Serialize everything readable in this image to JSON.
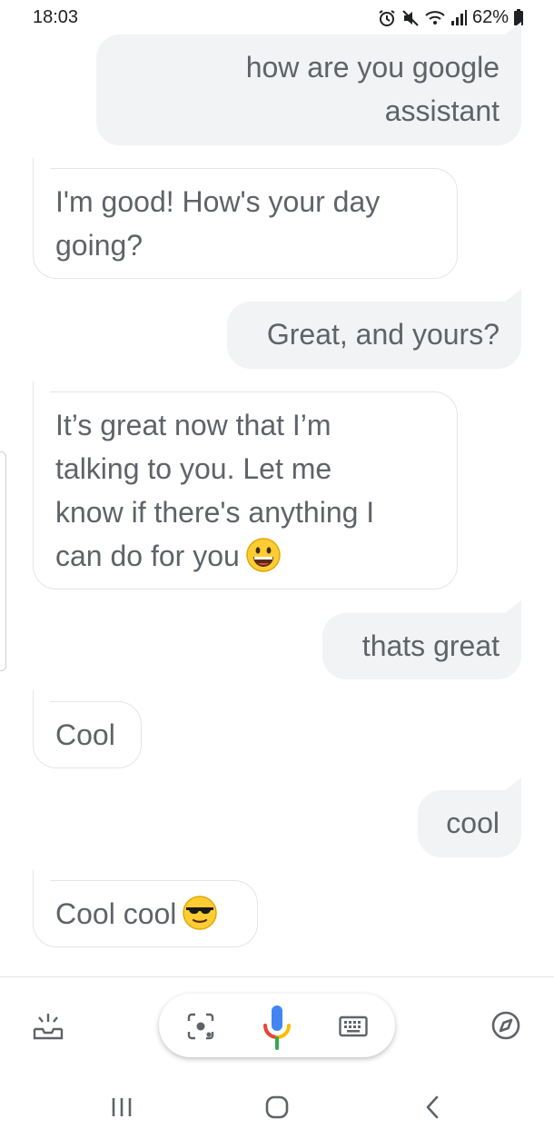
{
  "status_bar": {
    "time": "18:03",
    "battery": "62%",
    "icons": [
      "alarm-icon",
      "mute-icon",
      "wifi-icon",
      "signal-icon",
      "battery-icon"
    ]
  },
  "conversation": {
    "messages": [
      {
        "sender": "user",
        "text": "how are you google\nassistant"
      },
      {
        "sender": "assistant",
        "text": "I'm good! How's your day\ngoing?"
      },
      {
        "sender": "user",
        "text": "Great, and yours?"
      },
      {
        "sender": "assistant",
        "text": "It’s great now that I’m\ntalking to you. Let me\nknow if there's anything I\ncan do for you",
        "emoji": "grinning-face-emoji"
      },
      {
        "sender": "user",
        "text": "thats great"
      },
      {
        "sender": "assistant",
        "text": "Cool"
      },
      {
        "sender": "user",
        "text": "cool"
      },
      {
        "sender": "assistant",
        "text": "Cool cool",
        "emoji": "sunglasses-face-emoji"
      }
    ]
  },
  "bottom_bar": {
    "icons": [
      "updates-tray-icon",
      "lens-icon",
      "microphone-icon",
      "keyboard-icon",
      "explore-compass-icon"
    ]
  },
  "nav_bar": {
    "icons": [
      "recent-apps-icon",
      "home-icon",
      "back-icon"
    ]
  },
  "colors": {
    "user_bubble": "#f1f3f4",
    "assistant_border": "#e3e5e8",
    "text": "#5f6368",
    "mic_blue": "#4285f4",
    "mic_red": "#ea4335",
    "mic_yellow": "#fbbc04",
    "mic_green": "#34a853"
  }
}
